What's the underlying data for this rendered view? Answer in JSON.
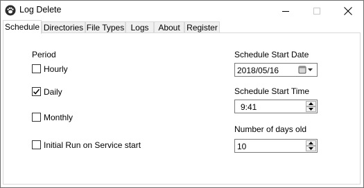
{
  "window": {
    "title": "Log Delete",
    "icon": "paw-icon"
  },
  "tabs": [
    {
      "label": "Schedule",
      "active": true
    },
    {
      "label": "Directories",
      "active": false
    },
    {
      "label": "File Types",
      "active": false
    },
    {
      "label": "Logs",
      "active": false
    },
    {
      "label": "About",
      "active": false
    },
    {
      "label": "Register",
      "active": false
    }
  ],
  "period": {
    "label": "Period",
    "options": [
      {
        "label": "Hourly",
        "checked": false
      },
      {
        "label": "Daily",
        "checked": true
      },
      {
        "label": "Monthly",
        "checked": false
      }
    ],
    "initial_run": {
      "label": "Initial Run on Service start",
      "checked": false
    }
  },
  "schedule_start_date": {
    "label": "Schedule Start Date",
    "value": "2018/05/16"
  },
  "schedule_start_time": {
    "label": "Schedule Start Time",
    "value": "9:41"
  },
  "days_old": {
    "label": "Number of days old",
    "value": "10"
  }
}
